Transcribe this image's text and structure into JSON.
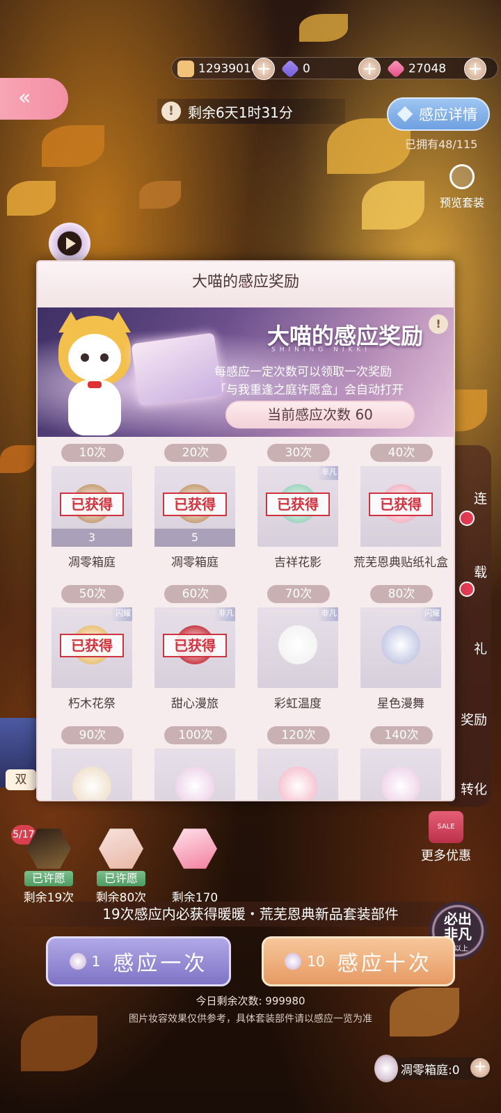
{
  "currency": {
    "gold": "12939016",
    "diamond_blue": "0",
    "diamond_pink": "27048",
    "plus": "+"
  },
  "header": {
    "back": "«",
    "timer_icon": "!",
    "timer": "剩余6天1时31分",
    "detail_button": "感应详情",
    "owned": "已拥有48/115",
    "preview": "预览套装"
  },
  "side_menu": {
    "items": [
      "连",
      "载",
      "礼",
      "奖励",
      "转化"
    ],
    "more_deals": "更多优惠",
    "sale": "SALE"
  },
  "left_panel": {
    "label": "双"
  },
  "modal": {
    "title": "大喵的感应奖励",
    "banner": {
      "title": "大喵的感应奖励",
      "subtitle": "SHINING NIKKI",
      "info": "!",
      "line1": "每感应一定次数可以领取一次奖励",
      "line2": "「与我重逢之庭许愿盒」会自动打开",
      "count": "当前感应次数 60"
    },
    "claimed_label": "已获得",
    "rewards": [
      {
        "times": "10次",
        "name": "凋零箱庭",
        "qty": "3",
        "claimed": true,
        "art": "#c8a27a"
      },
      {
        "times": "20次",
        "name": "凋零箱庭",
        "qty": "5",
        "claimed": true,
        "art": "#c8a27a"
      },
      {
        "times": "30次",
        "name": "吉祥花影",
        "qty": "",
        "claimed": true,
        "tag": "非凡",
        "art": "#9fd6c0"
      },
      {
        "times": "40次",
        "name": "荒芜恩典贴纸礼盒",
        "qty": "",
        "claimed": true,
        "art": "#f3b8c7"
      },
      {
        "times": "50次",
        "name": "朽木花祭",
        "qty": "",
        "claimed": true,
        "tag": "闪耀",
        "art": "#e9c37a"
      },
      {
        "times": "60次",
        "name": "甜心漫旅",
        "qty": "",
        "claimed": true,
        "tag": "非凡",
        "art": "#c9404a"
      },
      {
        "times": "70次",
        "name": "彩虹温度",
        "qty": "",
        "claimed": false,
        "tag": "非凡",
        "art": "#f4f4f4"
      },
      {
        "times": "80次",
        "name": "星色漫舞",
        "qty": "",
        "claimed": false,
        "tag": "闪耀",
        "art": "#c7cbe6"
      },
      {
        "times": "90次",
        "name": "",
        "qty": "",
        "claimed": false,
        "art": "#f1e3cf"
      },
      {
        "times": "100次",
        "name": "",
        "qty": "",
        "claimed": false,
        "art": "#f0d7ec"
      },
      {
        "times": "120次",
        "name": "",
        "qty": "",
        "claimed": false,
        "art": "#f7c6d3"
      },
      {
        "times": "140次",
        "name": "",
        "qty": "",
        "claimed": false,
        "art": "#f0d7ec"
      }
    ]
  },
  "wishes": {
    "progress": "5/17",
    "items": [
      {
        "tag": "已许愿",
        "remaining": "剩余19次"
      },
      {
        "tag": "已许愿",
        "remaining": "剩余80次"
      },
      {
        "tag": "",
        "remaining": "剩余170次"
      }
    ]
  },
  "guarantee": {
    "text": "19次感应内必获得暖暖・荒芜恩典新品套装部件",
    "badge_main": "必出非凡",
    "badge_sub": "或以上"
  },
  "draw": {
    "once_count": "1",
    "once_label": "感应一次",
    "ten_count": "10",
    "ten_label": "感应十次"
  },
  "footer": {
    "today": "今日剩余次数: 999980",
    "disclaimer": "图片妆容效果仅供参考，具体套装部件请以感应一览为准",
    "chest_count": "凋零箱庭:0",
    "plus": "+"
  },
  "colors": {
    "accent_pink": "#f38fa4",
    "accent_blue": "#6e9fe0",
    "stamp_red": "#d0323f",
    "draw_purple": "#7f73c5",
    "draw_orange": "#e69a63"
  }
}
